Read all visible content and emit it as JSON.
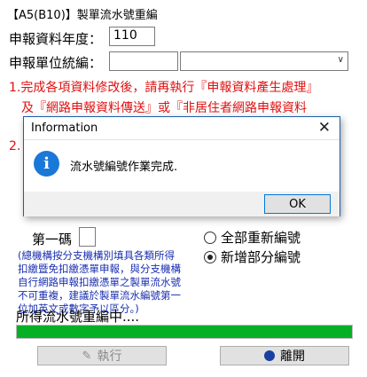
{
  "window": {
    "title": "【A5(B10)】製單流水號重編"
  },
  "form": {
    "year_label": "申報資料年度：",
    "year_value": "110",
    "unit_label": "申報單位統編：",
    "unit_value": "",
    "unit_select_value": ""
  },
  "notice_lines": [
    "1.完成各項資料修改後，請再執行『申報資料產生處理』",
    "及『網路申報資料傳送』或『非居住者網路申報資料",
    "2."
  ],
  "first_code": {
    "label": "第一碼",
    "value": ""
  },
  "radio_options": [
    {
      "label": "全部重新編號",
      "selected": false
    },
    {
      "label": "新增部分編號",
      "selected": true
    }
  ],
  "hint_lines": [
    "(總機構按分支機構別填具各類所得",
    "扣繳暨免扣繳憑單申報，與分支機構",
    "自行網路申報扣繳憑單之製單流水號",
    "不可重複，建議於製單流水編號第一",
    "位加英文或數字予以區分。)"
  ],
  "status": {
    "text": "所得流水號重編中....",
    "progress": 1.0
  },
  "buttons": {
    "execute": "執行",
    "leave": "離開"
  },
  "dialog": {
    "title": "Information",
    "message": "流水號編號作業完成.",
    "ok": "OK"
  },
  "colors": {
    "progress": "#06b025",
    "notice": "#e01010",
    "hint": "#1a2fb0",
    "info_icon": "#1a78d8"
  }
}
